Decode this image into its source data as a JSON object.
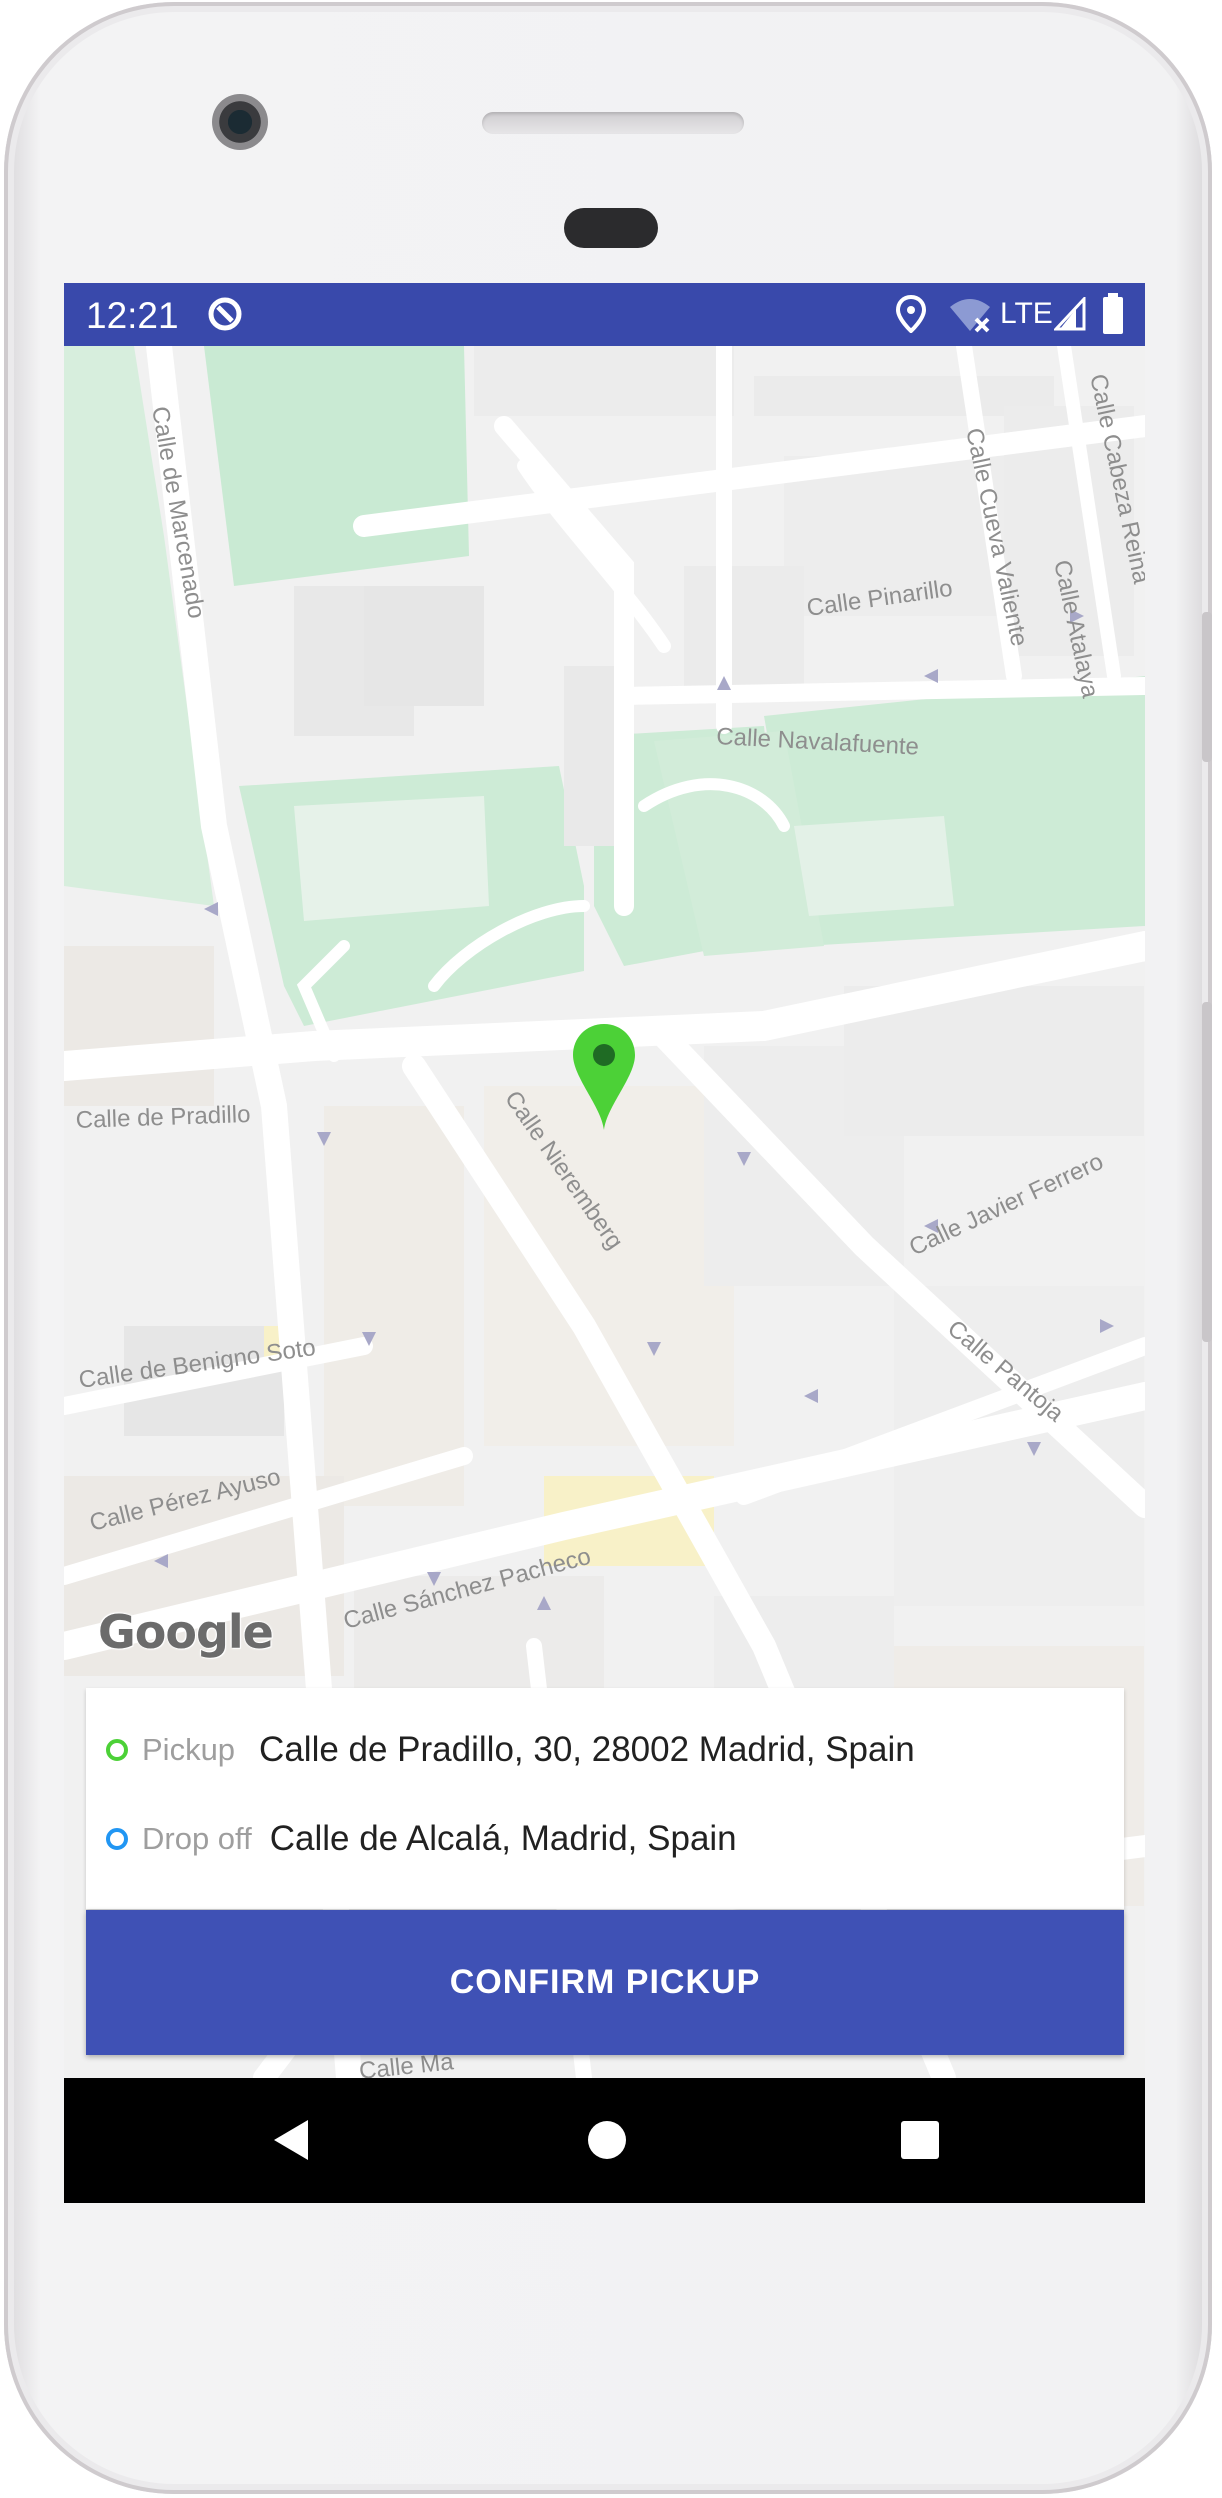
{
  "status_bar": {
    "time": "12:21",
    "network": "LTE",
    "background": "#3949ab",
    "icons": [
      "sync-icon",
      "location-icon",
      "wifi-off-icon",
      "signal-icon",
      "battery-icon"
    ]
  },
  "map": {
    "provider_logo": "Google",
    "street_labels": {
      "marcenado": "Calle de Marcenado",
      "cueva_valiente": "Calle Cueva Valiente",
      "cabeza_reina": "Calle Cabeza Reina",
      "pinarillo": "Calle Pinarillo",
      "atalaya": "Calle Atalaya",
      "navalafuente": "Calle Navalafuente",
      "pradillo": "Calle de Pradillo",
      "nieremberg": "Calle Nieremberg",
      "javier_ferrero": "Calle Javier Ferrero",
      "pantoja": "Calle Pantoja",
      "benigno_soto": "Calle de Benigno Soto",
      "perez_ayuso": "Calle Pérez Ayuso",
      "sanchez_pacheco": "Calle Sánchez Pacheco",
      "partial_bottom": "Calle Ma"
    },
    "pin_color": "#4cd137"
  },
  "trip": {
    "pickup_label": "Pickup",
    "pickup_value": "Calle de Pradillo, 30, 28002 Madrid, Spain",
    "pickup_color": "#4cd137",
    "dropoff_label": "Drop off",
    "dropoff_value": "Calle de Alcalá, Madrid, Spain",
    "dropoff_color": "#2196f3"
  },
  "confirm_button": {
    "label": "CONFIRM PICKUP",
    "color": "#3f51b5"
  },
  "nav_bar": {
    "icons": [
      "back-icon",
      "home-icon",
      "recents-icon"
    ]
  }
}
